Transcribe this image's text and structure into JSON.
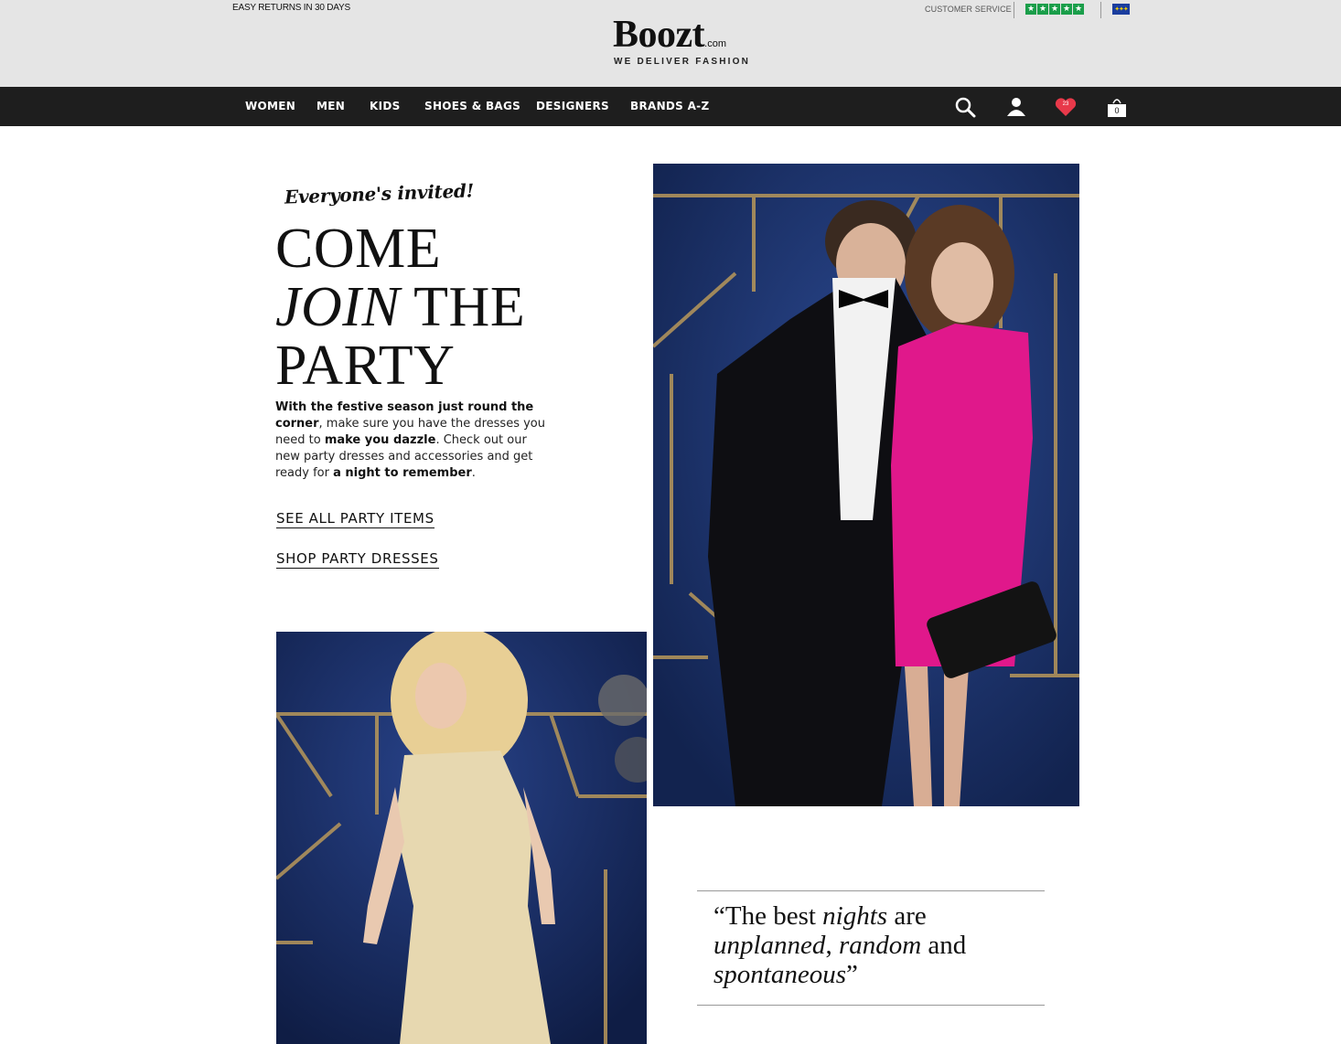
{
  "topbar": {
    "returns_text": "EASY RETURNS IN 30 DAYS",
    "customer_service": "CUSTOMER SERVICE",
    "rating_stars": 5,
    "rating_color": "#1a9e4a"
  },
  "logo": {
    "name": "Boozt",
    "suffix": ".com",
    "tagline": "WE DELIVER FASHION"
  },
  "nav": {
    "items": [
      "WOMEN",
      "MEN",
      "KIDS",
      "SHOES & BAGS",
      "DESIGNERS",
      "BRANDS A-Z"
    ],
    "icons": [
      "search-icon",
      "account-icon",
      "wishlist-heart-icon",
      "shopping-bag-icon"
    ],
    "wishlist_count": "23",
    "cart_count": "0",
    "heart_color": "#e8394a"
  },
  "hero": {
    "script": "Everyone's invited!",
    "headline_line1": "COME",
    "headline_line2_em": "JOIN",
    "headline_line2_rest": " THE",
    "headline_line3": "PARTY",
    "body": [
      {
        "text": "With the festive season just round the corner",
        "bold": true
      },
      {
        "text": ", make sure you have the dresses you need to ",
        "bold": false
      },
      {
        "text": "make you dazzle",
        "bold": true
      },
      {
        "text": ".  Check out our new party dresses and accessories and get ready for ",
        "bold": false
      },
      {
        "text": "a night to remember",
        "bold": true
      },
      {
        "text": ".",
        "bold": false
      }
    ],
    "link_all": "SEE ALL PARTY ITEMS",
    "link_dresses": "SHOP PARTY DRESSES"
  },
  "quote": {
    "open": "“The best ",
    "em1": "nights",
    "mid1": " are ",
    "em2": "unplanned",
    "mid2": ", ",
    "em3": "random",
    "mid3": " and ",
    "em4": "spontaneous",
    "close": "”"
  }
}
